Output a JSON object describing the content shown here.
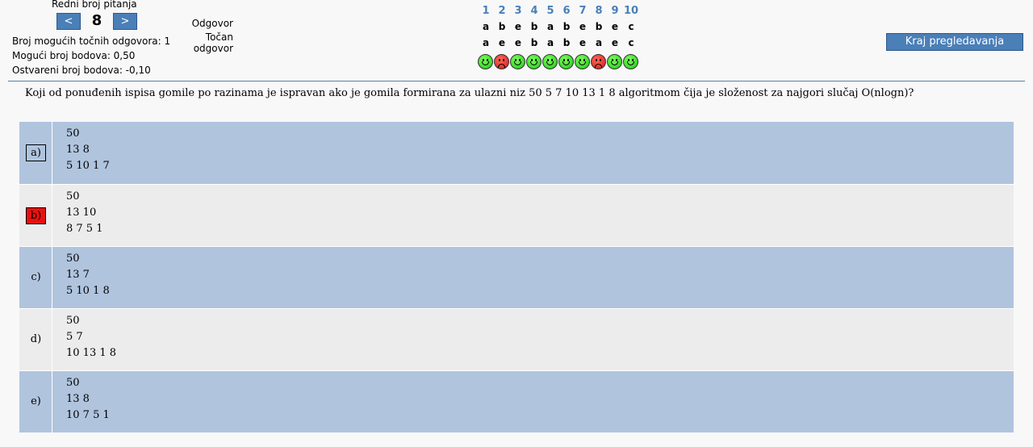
{
  "nav": {
    "title": "Redni broj pitanja",
    "prev_label": "<",
    "next_label": ">",
    "current": "8"
  },
  "info": {
    "possible_correct": "Broj mogućih točnih odgovora: 1",
    "possible_points": "Mogući broj bodova: 0,50",
    "earned_points": "Ostvareni broj bodova: -0,10"
  },
  "labels": {
    "answer": "Odgovor",
    "correct_line1": "Točan",
    "correct_line2": "odgovor"
  },
  "grid": {
    "numbers": [
      "1",
      "2",
      "3",
      "4",
      "5",
      "6",
      "7",
      "8",
      "9",
      "10"
    ],
    "answers": [
      "a",
      "b",
      "e",
      "b",
      "a",
      "b",
      "e",
      "b",
      "e",
      "c"
    ],
    "correct": [
      "a",
      "e",
      "e",
      "b",
      "a",
      "b",
      "e",
      "a",
      "e",
      "c"
    ],
    "results": [
      "good",
      "bad",
      "good",
      "good",
      "good",
      "good",
      "good",
      "bad",
      "good",
      "good"
    ]
  },
  "end_button": "Kraj pregledavanja",
  "question": "Koji od ponuđenih ispisa gomile po razinama je ispravan ako je gomila formirana za ulazni niz 50 5 7 10 13 1 8 algoritmom čija je složenost za najgori slučaj O(nlogn)?",
  "options": [
    {
      "label": "a)",
      "lines": [
        "50",
        "13 8",
        "5 10 1 7"
      ]
    },
    {
      "label": "b)",
      "lines": [
        "50",
        "13 10",
        "8 7 5 1"
      ]
    },
    {
      "label": "c)",
      "lines": [
        "50",
        "13 7",
        "5 10 1 8"
      ]
    },
    {
      "label": "d)",
      "lines": [
        "50",
        "5 7",
        "10 13 1 8"
      ]
    },
    {
      "label": "e)",
      "lines": [
        "50",
        "13 8",
        "10 7 5 1"
      ]
    }
  ],
  "colors": {
    "accent": "#4a7fb8",
    "row_blue": "#b0c4de",
    "row_gray": "#ececec",
    "wrong": "#e8110f"
  }
}
